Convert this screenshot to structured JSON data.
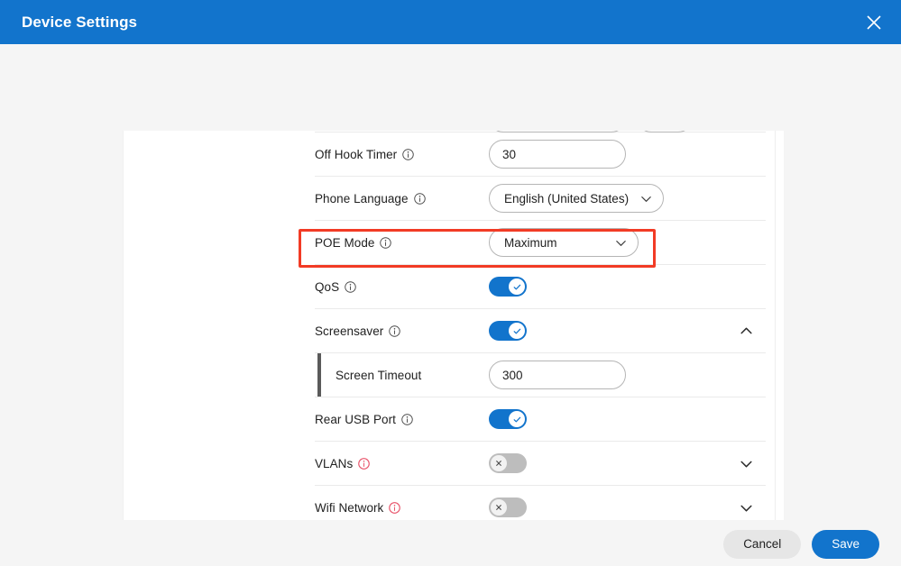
{
  "titlebar": {
    "title": "Device Settings",
    "close_icon": "close-icon"
  },
  "settings": {
    "rows": [
      {
        "label": "Off Hook Timer",
        "info_icon": "info-icon",
        "info_state": "normal",
        "control": "text",
        "value": "30"
      },
      {
        "label": "Phone Language",
        "info_icon": "info-icon",
        "info_state": "normal",
        "control": "select",
        "value": "English (United States)",
        "chevron_icon": "chevron-down-icon"
      },
      {
        "label": "POE Mode",
        "info_icon": "info-icon",
        "info_state": "normal",
        "control": "select",
        "value": "Maximum",
        "chevron_icon": "chevron-down-icon",
        "highlighted": true
      },
      {
        "label": "QoS",
        "info_icon": "info-icon",
        "info_state": "normal",
        "control": "toggle",
        "value": "on"
      },
      {
        "label": "Screensaver",
        "info_icon": "info-icon",
        "info_state": "normal",
        "control": "toggle",
        "value": "on",
        "expander_icon": "chevron-up-icon",
        "expanded": true
      },
      {
        "label": "Screen Timeout",
        "control": "text",
        "value": "300",
        "nested": true
      },
      {
        "label": "Rear USB Port",
        "info_icon": "info-icon",
        "info_state": "normal",
        "control": "toggle",
        "value": "on"
      },
      {
        "label": "VLANs",
        "info_icon": "info-icon",
        "info_state": "alert",
        "control": "toggle",
        "value": "off",
        "expander_icon": "chevron-down-icon"
      },
      {
        "label": "Wifi Network",
        "info_icon": "info-icon",
        "info_state": "alert",
        "control": "toggle",
        "value": "off",
        "expander_icon": "chevron-down-icon"
      }
    ]
  },
  "footer": {
    "cancel_label": "Cancel",
    "save_label": "Save"
  },
  "colors": {
    "brand_blue": "#1274cc",
    "highlight_red": "#f23b25",
    "alert_red": "#e8536a",
    "toggle_off_gray": "#bdbdbd"
  }
}
